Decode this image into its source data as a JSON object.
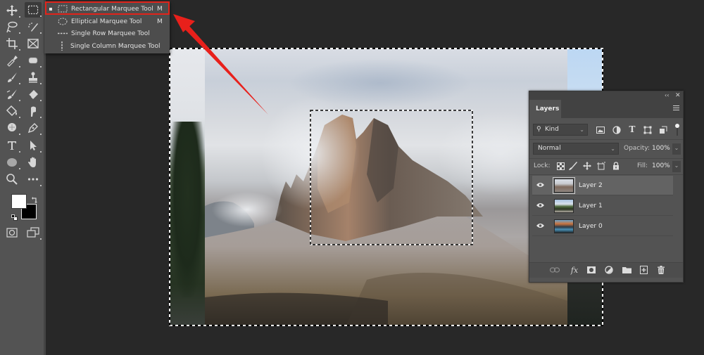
{
  "toolbar": {
    "tools": [
      {
        "name": "move-tool",
        "icon": "move-icon"
      },
      {
        "name": "rectangular-marquee-tool",
        "icon": "marquee-icon",
        "active": true
      },
      {
        "name": "lasso-tool",
        "icon": "lasso-icon"
      },
      {
        "name": "quick-selection-tool",
        "icon": "quick-selection-icon"
      },
      {
        "name": "crop-tool",
        "icon": "crop-icon"
      },
      {
        "name": "frame-tool",
        "icon": "frame-icon"
      },
      {
        "name": "eyedropper-tool",
        "icon": "eyedropper-icon"
      },
      {
        "name": "spot-healing-tool",
        "icon": "healing-icon"
      },
      {
        "name": "brush-tool",
        "icon": "brush-icon"
      },
      {
        "name": "clone-stamp-tool",
        "icon": "stamp-icon"
      },
      {
        "name": "history-brush-tool",
        "icon": "history-brush-icon"
      },
      {
        "name": "eraser-tool",
        "icon": "eraser-icon"
      },
      {
        "name": "paint-bucket-tool",
        "icon": "paint-bucket-icon"
      },
      {
        "name": "smudge-tool",
        "icon": "smudge-icon"
      },
      {
        "name": "dodge-tool",
        "icon": "dodge-icon"
      },
      {
        "name": "pen-tool",
        "icon": "pen-icon"
      },
      {
        "name": "type-tool",
        "icon": "type-icon"
      },
      {
        "name": "path-selection-tool",
        "icon": "arrow-icon"
      },
      {
        "name": "ellipse-tool",
        "icon": "ellipse-icon"
      },
      {
        "name": "hand-tool",
        "icon": "hand-icon"
      },
      {
        "name": "zoom-tool",
        "icon": "zoom-icon"
      },
      {
        "name": "edit-toolbar",
        "icon": "more-icon"
      }
    ],
    "foreground_color": "#ffffff",
    "background_color": "#000000"
  },
  "flyout": {
    "items": [
      {
        "label": "Rectangular Marquee Tool",
        "shortcut": "M",
        "selected": true,
        "icon": "rect-marquee-icon"
      },
      {
        "label": "Elliptical Marquee Tool",
        "shortcut": "M",
        "selected": false,
        "icon": "ellipse-marquee-icon"
      },
      {
        "label": "Single Row Marquee Tool",
        "shortcut": "",
        "selected": false,
        "icon": "single-row-icon"
      },
      {
        "label": "Single Column Marquee Tool",
        "shortcut": "",
        "selected": false,
        "icon": "single-column-icon"
      }
    ],
    "highlight_color": "#e2231a"
  },
  "layers_panel": {
    "tab_label": "Layers",
    "filter_kind": "Kind",
    "blend_mode": "Normal",
    "opacity_label": "Opacity:",
    "opacity_value": "100%",
    "lock_label": "Lock:",
    "fill_label": "Fill:",
    "fill_value": "100%",
    "layers": [
      {
        "name": "Layer 2",
        "visible": true,
        "selected": true
      },
      {
        "name": "Layer 1",
        "visible": true,
        "selected": false
      },
      {
        "name": "Layer 0",
        "visible": true,
        "selected": false
      }
    ]
  },
  "annotation": {
    "arrow_color": "#e8201b"
  }
}
